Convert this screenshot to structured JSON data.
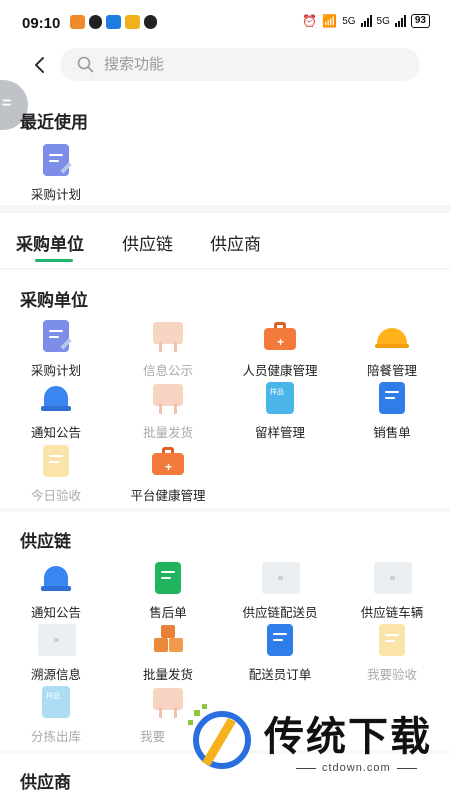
{
  "status_bar": {
    "time": "09:10",
    "network_label": "5G",
    "network_label_2": "5G",
    "battery": "93"
  },
  "search": {
    "placeholder": "搜索功能"
  },
  "recent": {
    "title": "最近使用",
    "items": [
      {
        "label": "采购计划",
        "icon": "purchase-plan-icon"
      }
    ]
  },
  "tabs": [
    {
      "label": "采购单位",
      "active": true
    },
    {
      "label": "供应链",
      "active": false
    },
    {
      "label": "供应商",
      "active": false
    }
  ],
  "sections": {
    "purchase_unit": {
      "title": "采购单位",
      "items": [
        {
          "label": "采购计划",
          "icon": "purchase-plan-icon"
        },
        {
          "label": "信息公示",
          "icon": "notice-board-icon"
        },
        {
          "label": "人员健康管理",
          "icon": "health-kit-icon"
        },
        {
          "label": "陪餐管理",
          "icon": "meal-cloche-icon"
        },
        {
          "label": "通知公告",
          "icon": "bell-icon"
        },
        {
          "label": "批量发货",
          "icon": "notice-board-icon"
        },
        {
          "label": "留样管理",
          "icon": "sample-icon"
        },
        {
          "label": "销售单",
          "icon": "sales-doc-icon"
        },
        {
          "label": "今日验收",
          "icon": "acceptance-icon"
        },
        {
          "label": "平台健康管理",
          "icon": "health-kit-icon"
        }
      ]
    },
    "supply_chain": {
      "title": "供应链",
      "items": [
        {
          "label": "通知公告",
          "icon": "bell-icon"
        },
        {
          "label": "售后单",
          "icon": "after-sales-icon"
        },
        {
          "label": "供应链配送员",
          "icon": "image-placeholder-icon"
        },
        {
          "label": "供应链车辆",
          "icon": "image-placeholder-icon"
        },
        {
          "label": "溯源信息",
          "icon": "image-placeholder-icon"
        },
        {
          "label": "批量发货",
          "icon": "packages-icon"
        },
        {
          "label": "配送员订单",
          "icon": "delivery-order-icon"
        },
        {
          "label": "我要验收",
          "icon": "acceptance-icon"
        },
        {
          "label": "分拣出库",
          "icon": "sample-icon"
        },
        {
          "label": "我要",
          "icon": "notice-board-icon"
        }
      ]
    },
    "supplier": {
      "title": "供应商"
    }
  },
  "sample_badge": "样品",
  "watermark": {
    "text": "传统下载",
    "url": "ctdown.com"
  },
  "colors": {
    "accent": "#1db36a",
    "blue": "#3a86f0",
    "orange": "#ec7a3a",
    "yellow": "#ffb21c"
  }
}
